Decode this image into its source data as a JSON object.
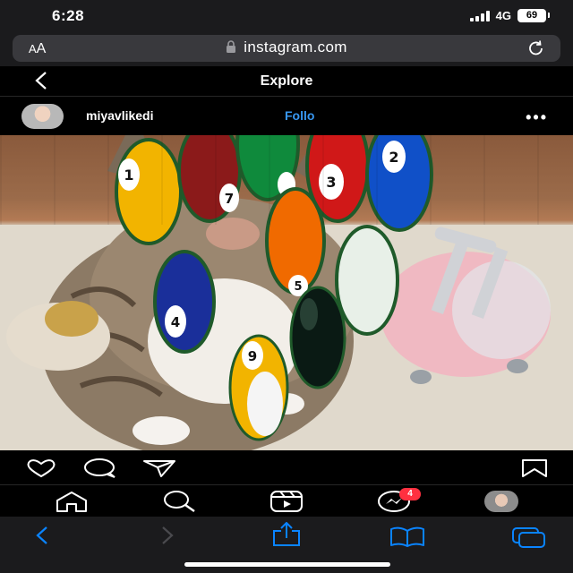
{
  "status": {
    "time": "6:28",
    "network": "4G",
    "battery": "69"
  },
  "browser": {
    "aa_label_small": "A",
    "aa_label_big": "A",
    "url": "instagram.com"
  },
  "instagram": {
    "page_title": "Explore",
    "post": {
      "username": "miyavlikedi",
      "follow_label": "Follo"
    },
    "nav": {
      "messages_badge": "4"
    }
  },
  "image": {
    "description_icon": "cat-with-billiard-balls"
  },
  "billiard_balls": [
    {
      "number": "1",
      "color": "#f2b400"
    },
    {
      "number": "7",
      "color": "#8b1a1a"
    },
    {
      "number": "",
      "color": "#0f8a3c"
    },
    {
      "number": "3",
      "color": "#d01818"
    },
    {
      "number": "2",
      "color": "#1050c8"
    },
    {
      "number": "5",
      "color": "#f06a00"
    },
    {
      "number": "4",
      "color": "#1a2f9a"
    },
    {
      "number": "",
      "color": "#e8f0e8"
    },
    {
      "number": "",
      "color": "#0a1a14"
    },
    {
      "number": "9",
      "color": "#f2b400"
    }
  ],
  "colors": {
    "accent": "#3897f0",
    "badge": "#ff3040",
    "safari_blue": "#0a84ff"
  }
}
